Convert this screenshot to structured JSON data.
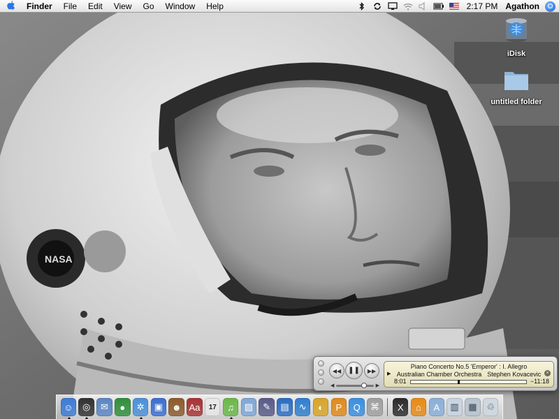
{
  "menubar": {
    "apple_icon": "apple-icon",
    "app_name": "Finder",
    "menus": [
      "File",
      "Edit",
      "View",
      "Go",
      "Window",
      "Help"
    ],
    "status_icons": [
      "bluetooth-icon",
      "sync-icon",
      "display-icon",
      "wifi-icon",
      "volume-icon",
      "battery-icon",
      "flag-icon"
    ],
    "clock": "2:17 PM",
    "user": "Agathon",
    "spotlight_icon": "spotlight-icon"
  },
  "desktop_icons": [
    {
      "label": "iDisk",
      "icon": "idisk-icon"
    },
    {
      "label": "untitled folder",
      "icon": "folder-icon"
    }
  ],
  "itunes_mini": {
    "track_title": "Piano Concerto No.5 'Emperor' : I. Allegro",
    "album": "Australian Chamber Orchestra",
    "artist": "Stephen Kovacevic",
    "elapsed": "8:01",
    "remaining": "−11:18",
    "progress": 0.41,
    "volume": 0.75,
    "prev_icon": "previous-icon",
    "play_icon": "pause-icon",
    "next_icon": "next-icon"
  },
  "dock": {
    "apps": [
      {
        "name": "finder",
        "icon": "finder-icon",
        "color": "#3d7bd6",
        "running": true
      },
      {
        "name": "dashboard",
        "icon": "dashboard-icon",
        "color": "#303030",
        "running": true
      },
      {
        "name": "mail",
        "icon": "mail-icon",
        "color": "#5a86c4",
        "running": false
      },
      {
        "name": "ichat",
        "icon": "ichat-icon",
        "color": "#2f8f3a",
        "running": false
      },
      {
        "name": "safari",
        "icon": "safari-icon",
        "color": "#4a90d9",
        "running": true
      },
      {
        "name": "ichat-av",
        "icon": "video-icon",
        "color": "#3a6fd0",
        "running": false
      },
      {
        "name": "address-book",
        "icon": "address-book-icon",
        "color": "#8b5a2b",
        "running": false
      },
      {
        "name": "dictionary",
        "icon": "dictionary-icon",
        "color": "#a83232",
        "running": false
      },
      {
        "name": "ical",
        "icon": "calendar-icon",
        "color": "#e8e8e8",
        "running": false
      },
      {
        "name": "itunes",
        "icon": "itunes-icon",
        "color": "#6bb84a",
        "running": true
      },
      {
        "name": "iphoto",
        "icon": "iphoto-icon",
        "color": "#7fa7d8",
        "running": false
      },
      {
        "name": "pen-app",
        "icon": "pen-icon",
        "color": "#5a5a8a",
        "running": false
      },
      {
        "name": "preview",
        "icon": "preview-icon",
        "color": "#2b6cc4",
        "running": false
      },
      {
        "name": "iweb",
        "icon": "iweb-icon",
        "color": "#2f7fd0",
        "running": false
      },
      {
        "name": "messages",
        "icon": "chat-bubble-icon",
        "color": "#d9a52a",
        "running": false
      },
      {
        "name": "pages",
        "icon": "pages-icon",
        "color": "#e08a1c",
        "running": false
      },
      {
        "name": "quicktime",
        "icon": "quicktime-icon",
        "color": "#3a8fe0",
        "running": false
      },
      {
        "name": "system-preferences",
        "icon": "apple-prefs-icon",
        "color": "#a0a0a0",
        "running": false
      }
    ],
    "others": [
      {
        "name": "x11",
        "icon": "x11-icon",
        "color": "#2a2a2a"
      },
      {
        "name": "home-folder",
        "icon": "home-icon",
        "color": "#e88a14"
      },
      {
        "name": "applications-folder",
        "icon": "applications-folder-icon",
        "color": "#8ab0d8"
      },
      {
        "name": "documents-stack",
        "icon": "documents-icon",
        "color": "#c9d4e0"
      },
      {
        "name": "downloads-stack",
        "icon": "downloads-icon",
        "color": "#b8c4d0"
      },
      {
        "name": "trash",
        "icon": "trash-icon",
        "color": "#cfd8e0"
      }
    ]
  }
}
